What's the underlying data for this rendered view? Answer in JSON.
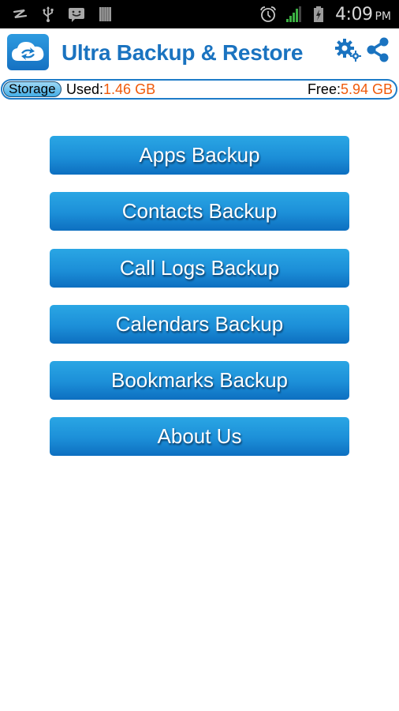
{
  "status_bar": {
    "left_icons": [
      "zte-logo-icon",
      "usb-icon",
      "messaging-icon",
      "barcode-icon"
    ],
    "right_icons": [
      "alarm-icon",
      "signal-icon",
      "battery-charging-icon"
    ],
    "time": "4:09",
    "ampm": "PM"
  },
  "header": {
    "logo_icon": "cloud-sync-icon",
    "title": "Ultra Backup & Restore",
    "settings_icon": "gears-icon",
    "share_icon": "share-icon"
  },
  "storage": {
    "label": "Storage",
    "used_label": "Used:",
    "used_value": "1.46 GB",
    "free_label": "Free:",
    "free_value": "5.94 GB"
  },
  "menu": {
    "buttons": [
      {
        "label": "Apps Backup"
      },
      {
        "label": "Contacts Backup"
      },
      {
        "label": "Call Logs Backup"
      },
      {
        "label": "Calendars Backup"
      },
      {
        "label": "Bookmarks Backup"
      },
      {
        "label": "About Us"
      }
    ]
  },
  "colors": {
    "accent": "#1a73c0",
    "button_top": "#2aa6e4",
    "button_bottom": "#0d6fc0",
    "value_orange": "#f05a0a"
  }
}
